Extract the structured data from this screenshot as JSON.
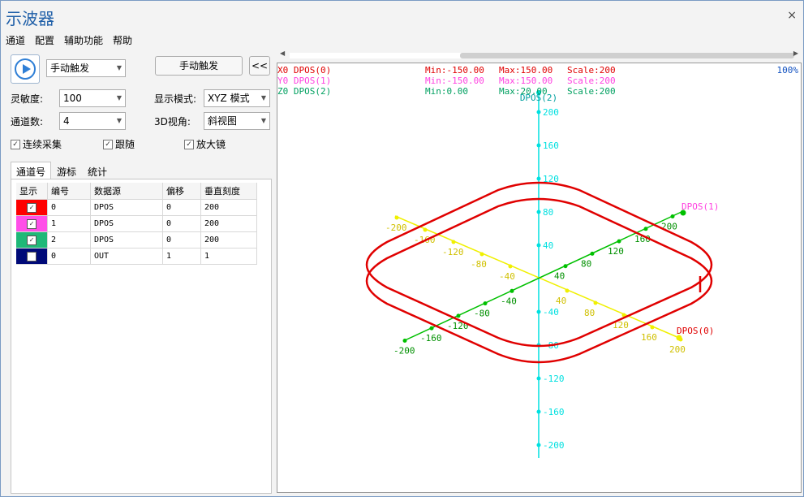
{
  "app": {
    "title": "示波器",
    "close_glyph": "×"
  },
  "menu": [
    "通道",
    "配置",
    "辅助功能",
    "帮助"
  ],
  "controls": {
    "trigger_mode": "手动触发",
    "manual_trigger_button": "手动触发",
    "collapse_button": "<<",
    "sensitivity_label": "灵敏度:",
    "sensitivity_value": "100",
    "display_mode_label": "显示模式:",
    "display_mode_value": "XYZ 模式",
    "channel_count_label": "通道数:",
    "channel_count_value": "4",
    "view3d_label": "3D视角:",
    "view3d_value": "斜视图",
    "continuous_label": "连续采集",
    "follow_label": "跟随",
    "magnifier_label": "放大镜"
  },
  "tabs": [
    "通道号",
    "游标",
    "统计"
  ],
  "table": {
    "headers": [
      "显示",
      "编号",
      "数据源",
      "偏移",
      "垂直刻度"
    ],
    "rows": [
      {
        "color": "#ff0000",
        "checked": true,
        "num": "0",
        "src": "DPOS",
        "offset": "0",
        "scale": "200"
      },
      {
        "color": "#ff4fe8",
        "checked": true,
        "num": "1",
        "src": "DPOS",
        "offset": "0",
        "scale": "200"
      },
      {
        "color": "#20b878",
        "checked": true,
        "num": "2",
        "src": "DPOS",
        "offset": "0",
        "scale": "200"
      },
      {
        "color": "#000a78",
        "checked": false,
        "num": "0",
        "src": "OUT",
        "offset": "1",
        "scale": "1"
      }
    ]
  },
  "scope": {
    "zoom": "100%",
    "channels": [
      {
        "name": "X0 DPOS(0)",
        "min": "Min:-150.00",
        "max": "Max:150.00",
        "scale": "Scale:200",
        "color": "#e00000"
      },
      {
        "name": "Y0 DPOS(1)",
        "min": "Min:-150.00",
        "max": "Max:150.00",
        "scale": "Scale:200",
        "color": "#ff40e0"
      },
      {
        "name": "Z0 DPOS(2)",
        "min": "Min:0.00",
        "max": "Max:20.00",
        "scale": "Scale:200",
        "color": "#00a060"
      }
    ],
    "axis_names": {
      "x": "DPOS(0)",
      "y": "DPOS(1)",
      "z": "DPOS(2)"
    },
    "z_ticks": [
      "200",
      "160",
      "120",
      "80",
      "40",
      "-40",
      "-80",
      "-120",
      "-160",
      "-200"
    ],
    "x_ticks": [
      "-200",
      "-160",
      "-120",
      "-80",
      "-40",
      "40",
      "80",
      "120",
      "160",
      "200"
    ],
    "y_ticks": [
      "-200",
      "-160",
      "-120",
      "-80",
      "-40",
      "40",
      "80",
      "120",
      "160",
      "200"
    ],
    "colors": {
      "z_axis": "#00e0e0",
      "x_axis": "#f0f000",
      "y_axis": "#00c000",
      "trace": "#e00000"
    }
  }
}
